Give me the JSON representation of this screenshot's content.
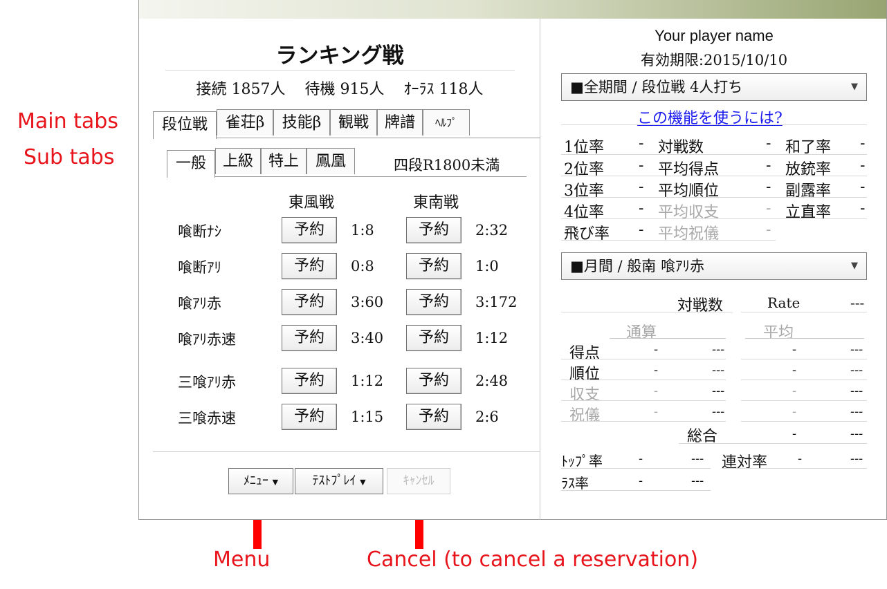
{
  "annotations": {
    "main_tabs": "Main tabs",
    "sub_tabs": "Sub tabs",
    "menu": "Menu",
    "cancel": "Cancel (to cancel a reservation)"
  },
  "lobby": {
    "title": "ランキング戦",
    "status": {
      "connected": "接続 1857人",
      "waiting": "待機 915人",
      "oorasu": "ｵｰﾗｽ 118人"
    },
    "main_tabs": [
      "段位戦",
      "雀荘β",
      "技能β",
      "観戦",
      "牌譜",
      "ﾍﾙﾌﾟ"
    ],
    "sub_tabs": [
      "一般",
      "上級",
      "特上",
      "鳳凰"
    ],
    "rank_requirement": "四段R1800未満",
    "columns": [
      "東風戦",
      "東南戦"
    ],
    "reserve_label": "予約",
    "rows": [
      {
        "name": "喰断ﾅｼ",
        "east": "1:8",
        "south": "2:32"
      },
      {
        "name": "喰断ｱﾘ",
        "east": "0:8",
        "south": "1:0"
      },
      {
        "name": "喰ｱﾘ赤",
        "east": "3:60",
        "south": "3:172"
      },
      {
        "name": "喰ｱﾘ赤速",
        "east": "3:40",
        "south": "1:12"
      },
      {
        "name": "三喰ｱﾘ赤",
        "east": "1:12",
        "south": "2:48"
      },
      {
        "name": "三喰赤速",
        "east": "1:15",
        "south": "2:6"
      }
    ],
    "bottom_buttons": {
      "menu": "ﾒﾆｭｰ",
      "testplay": "ﾃｽﾄﾌﾟﾚｲ",
      "cancel": "ｷｬﾝｾﾙ"
    },
    "dropdown_arrow": "▼"
  },
  "profile": {
    "player_name": "Your player name",
    "expiry": "有効期限:2015/10/10",
    "period_select": "■全期間 / 段位戦 4人打ち",
    "help_link": "この機能を使うには?",
    "stats": [
      [
        "1位率",
        "-",
        "対戦数",
        "-",
        "和了率",
        "-"
      ],
      [
        "2位率",
        "-",
        "平均得点",
        "-",
        "放銃率",
        "-"
      ],
      [
        "3位率",
        "-",
        "平均順位",
        "-",
        "副露率",
        "-"
      ],
      [
        "4位率",
        "-",
        "平均収支",
        "-",
        "立直率",
        "-"
      ],
      [
        "飛び率",
        "-",
        "平均祝儀",
        "-"
      ]
    ],
    "month_select": "■月間 / 般南 喰ｱﾘ赤",
    "rate": {
      "games_label": "対戦数",
      "rate_label": "Rate",
      "rate_value": "---"
    },
    "totals_header": "通算",
    "average_header": "平均",
    "detail": [
      [
        "得点",
        "-",
        "---",
        "-",
        "---"
      ],
      [
        "順位",
        "-",
        "---",
        "-",
        "---"
      ],
      [
        "収支",
        "-",
        "---",
        "-",
        "---"
      ],
      [
        "祝儀",
        "-",
        "---",
        "-",
        "---"
      ]
    ],
    "overall": {
      "label": "総合",
      "value1": "-",
      "value2": "---"
    },
    "top_rate": {
      "label": "ﾄｯﾌﾟ率",
      "value1": "-",
      "value2": "---"
    },
    "renpai_rate": {
      "label": "連対率",
      "value1": "-",
      "value2": "---"
    },
    "last_rate": {
      "label": "ﾗｽ率",
      "value1": "-",
      "value2": "---"
    }
  },
  "colors": {
    "annotation": "#e8141b",
    "arrow": "#ff0000",
    "link": "#1a1aee",
    "disabled": "#a8a8a8"
  }
}
